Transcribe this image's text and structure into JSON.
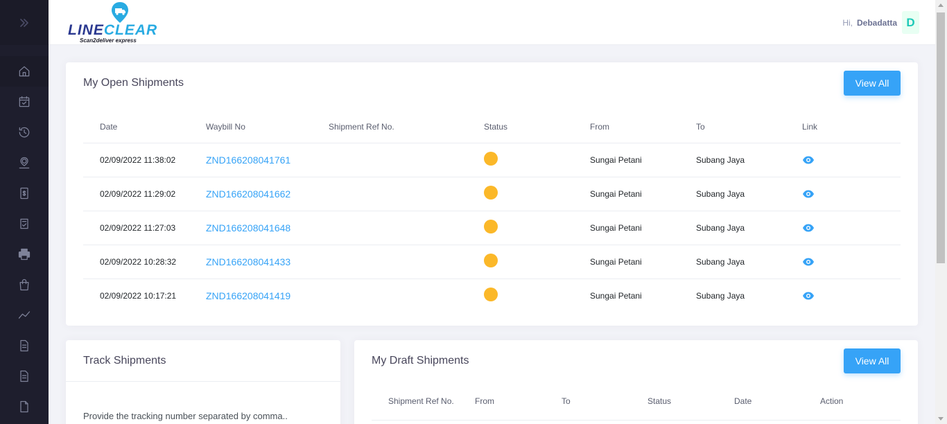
{
  "brand": {
    "logo_line": "LINE",
    "logo_clear": "CLEAR",
    "tagline": "Scan2deliver express"
  },
  "user": {
    "greeting": "Hi,",
    "name": "Debadatta",
    "avatar_letter": "D"
  },
  "sidebar": {
    "toggle_icon": "chevrons-right-icon",
    "items": [
      {
        "icon": "home-icon"
      },
      {
        "icon": "calendar-check-icon"
      },
      {
        "icon": "history-icon"
      },
      {
        "icon": "user-location-icon"
      },
      {
        "icon": "receipt-icon"
      },
      {
        "icon": "clipboard-check-icon"
      },
      {
        "icon": "printer-icon"
      },
      {
        "icon": "shopping-bag-icon"
      },
      {
        "icon": "chart-line-icon"
      },
      {
        "icon": "document-icon"
      },
      {
        "icon": "document-icon"
      },
      {
        "icon": "file-export-icon"
      }
    ]
  },
  "open_shipments": {
    "title": "My Open Shipments",
    "view_all": "View All",
    "columns": [
      "Date",
      "Waybill No",
      "Shipment Ref No.",
      "Status",
      "From",
      "To",
      "Link"
    ],
    "rows": [
      {
        "date": "02/09/2022 11:38:02",
        "waybill": "ZND166208041761",
        "ref": "",
        "status": "pending",
        "from": "Sungai Petani",
        "to": "Subang Jaya"
      },
      {
        "date": "02/09/2022 11:29:02",
        "waybill": "ZND166208041662",
        "ref": "",
        "status": "pending",
        "from": "Sungai Petani",
        "to": "Subang Jaya"
      },
      {
        "date": "02/09/2022 11:27:03",
        "waybill": "ZND166208041648",
        "ref": "",
        "status": "pending",
        "from": "Sungai Petani",
        "to": "Subang Jaya"
      },
      {
        "date": "02/09/2022 10:28:32",
        "waybill": "ZND166208041433",
        "ref": "",
        "status": "pending",
        "from": "Sungai Petani",
        "to": "Subang Jaya"
      },
      {
        "date": "02/09/2022 10:17:21",
        "waybill": "ZND166208041419",
        "ref": "",
        "status": "pending",
        "from": "Sungai Petani",
        "to": "Subang Jaya"
      }
    ],
    "status_color": "#fbb829"
  },
  "track_shipments": {
    "title": "Track Shipments",
    "placeholder": "Provide the tracking number separated by comma.."
  },
  "draft_shipments": {
    "title": "My Draft Shipments",
    "view_all": "View All",
    "columns": [
      "Shipment Ref No.",
      "From",
      "To",
      "Status",
      "Date",
      "Action"
    ]
  },
  "colors": {
    "sidebar_bg": "#1e1e2d",
    "accent": "#36a3f7",
    "status_pending": "#fbb829"
  }
}
